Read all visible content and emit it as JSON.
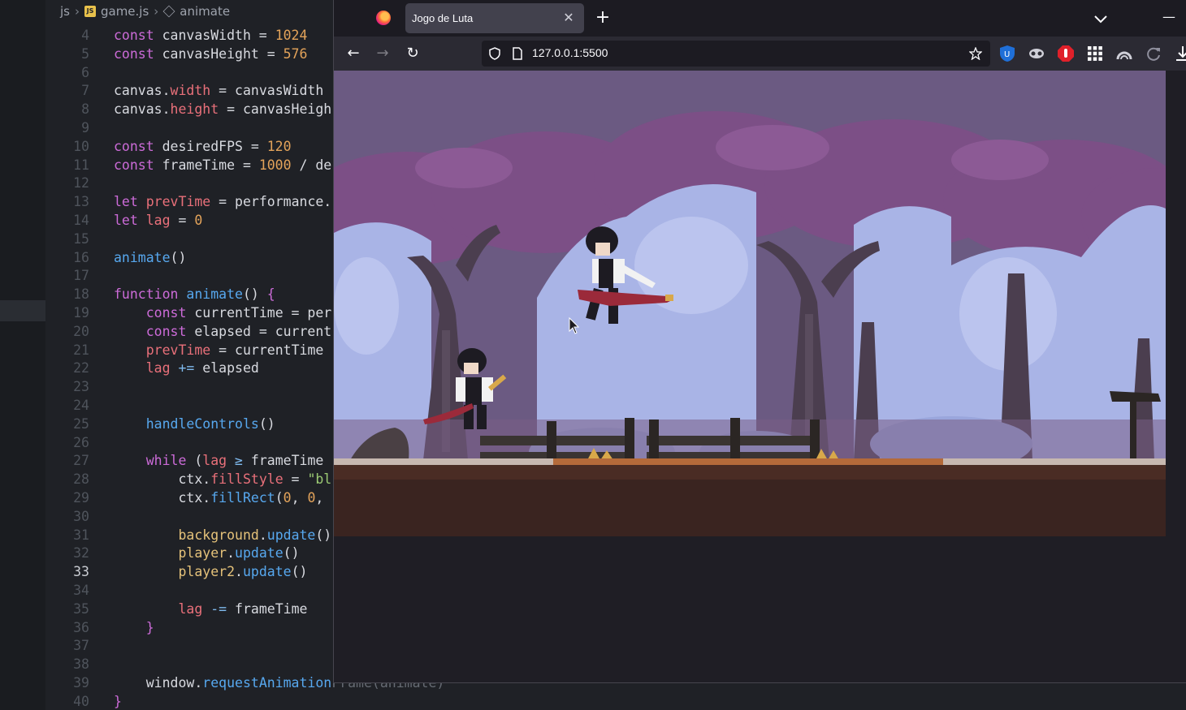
{
  "editor": {
    "breadcrumb": {
      "folder": "js",
      "file_badge": "JS",
      "file": "game.js",
      "symbol": "animate"
    },
    "lines": [
      {
        "n": "4",
        "active": false,
        "html": "<span class='kw'>const</span> canvasWidth = <span class='num'>1024</span>"
      },
      {
        "n": "5",
        "active": false,
        "html": "<span class='kw'>const</span> canvasHeight = <span class='num'>576</span>"
      },
      {
        "n": "6",
        "active": false,
        "html": ""
      },
      {
        "n": "7",
        "active": false,
        "html": "canvas.<span class='prop'>width</span> = canvasWidth"
      },
      {
        "n": "8",
        "active": false,
        "html": "canvas.<span class='prop'>height</span> = canvasHeigh"
      },
      {
        "n": "9",
        "active": false,
        "html": ""
      },
      {
        "n": "10",
        "active": false,
        "html": "<span class='kw'>const</span> desiredFPS = <span class='num'>120</span>"
      },
      {
        "n": "11",
        "active": false,
        "html": "<span class='kw'>const</span> frameTime = <span class='num'>1000</span> / de"
      },
      {
        "n": "12",
        "active": false,
        "html": ""
      },
      {
        "n": "13",
        "active": false,
        "html": "<span class='kw'>let</span> <span class='prop'>prevTime</span> = performance."
      },
      {
        "n": "14",
        "active": false,
        "html": "<span class='kw'>let</span> <span class='prop'>lag</span> = <span class='num'>0</span>"
      },
      {
        "n": "15",
        "active": false,
        "html": ""
      },
      {
        "n": "16",
        "active": false,
        "html": "<span class='fn'>animate</span>()"
      },
      {
        "n": "17",
        "active": false,
        "html": ""
      },
      {
        "n": "18",
        "active": false,
        "html": "<span class='kw'>function</span> <span class='fn'>animate</span>() <span class='bracket'>{</span>"
      },
      {
        "n": "19",
        "active": false,
        "html": "    <span class='kw'>const</span> currentTime = per"
      },
      {
        "n": "20",
        "active": false,
        "html": "    <span class='kw'>const</span> elapsed = current"
      },
      {
        "n": "21",
        "active": false,
        "html": "    <span class='prop'>prevTime</span> = currentTime"
      },
      {
        "n": "22",
        "active": false,
        "html": "    <span class='prop'>lag</span> <span class='op'>+=</span> elapsed"
      },
      {
        "n": "23",
        "active": false,
        "html": ""
      },
      {
        "n": "24",
        "active": false,
        "html": ""
      },
      {
        "n": "25",
        "active": false,
        "html": "    <span class='fn'>handleControls</span>()"
      },
      {
        "n": "26",
        "active": false,
        "html": ""
      },
      {
        "n": "27",
        "active": false,
        "html": "    <span class='kw'>while</span> (<span class='prop'>lag</span> <span class='op'>≥</span> frameTime"
      },
      {
        "n": "28",
        "active": false,
        "html": "        ctx.<span class='prop'>fillStyle</span> = <span class='str'>\"bl</span>"
      },
      {
        "n": "29",
        "active": false,
        "html": "        ctx.<span class='fn'>fillRect</span>(<span class='num'>0</span>, <span class='num'>0</span>,"
      },
      {
        "n": "30",
        "active": false,
        "html": ""
      },
      {
        "n": "31",
        "active": false,
        "html": "        <span class='var'>background</span>.<span class='fn'>update</span>()"
      },
      {
        "n": "32",
        "active": false,
        "html": "        <span class='var'>player</span>.<span class='fn'>update</span>()"
      },
      {
        "n": "33",
        "active": true,
        "html": "        <span class='var'>player2</span>.<span class='fn'>update</span>()"
      },
      {
        "n": "34",
        "active": false,
        "html": ""
      },
      {
        "n": "35",
        "active": false,
        "html": "        <span class='prop'>lag</span> <span class='op'>-=</span> frameTime"
      },
      {
        "n": "36",
        "active": false,
        "html": "    <span class='bracket'>}</span>"
      },
      {
        "n": "37",
        "active": false,
        "html": ""
      },
      {
        "n": "38",
        "active": false,
        "html": ""
      },
      {
        "n": "39",
        "active": false,
        "html": "    window.<span class='fn'>requestAnimation</span><span class='dim'>Frame(animate)</span>"
      },
      {
        "n": "40",
        "active": false,
        "html": "<span class='bracket'>}</span>"
      }
    ]
  },
  "browser": {
    "tab_title": "Jogo de Luta",
    "tab_close": "✕",
    "new_tab": "+",
    "minimize": "—",
    "back": "←",
    "forward": "→",
    "reload": "↻",
    "url": "127.0.0.1:5500",
    "icons": [
      "firefox-logo-icon",
      "shield-icon",
      "page-icon",
      "bookmark-star-icon",
      "ublock-icon",
      "mask-icon",
      "adblock-icon",
      "grid-icon",
      "vpn-icon",
      "sync-icon",
      "download-icon",
      "tab-list-chevron-icon"
    ]
  },
  "game": {
    "colors": {
      "sky": "#6b5a82",
      "canopy_purple": "#7c4f86",
      "mist": "#a9b4e6",
      "trunk": "#4b3e4f",
      "ground_top": "#b46a3a",
      "ground": "#3a2420",
      "player_shirt": "#f2f2f2",
      "player_vest": "#1d1b22",
      "sword": "#9b2a3a"
    },
    "state": {
      "player1": "standing with sword",
      "player2": "jumping with sword"
    }
  }
}
